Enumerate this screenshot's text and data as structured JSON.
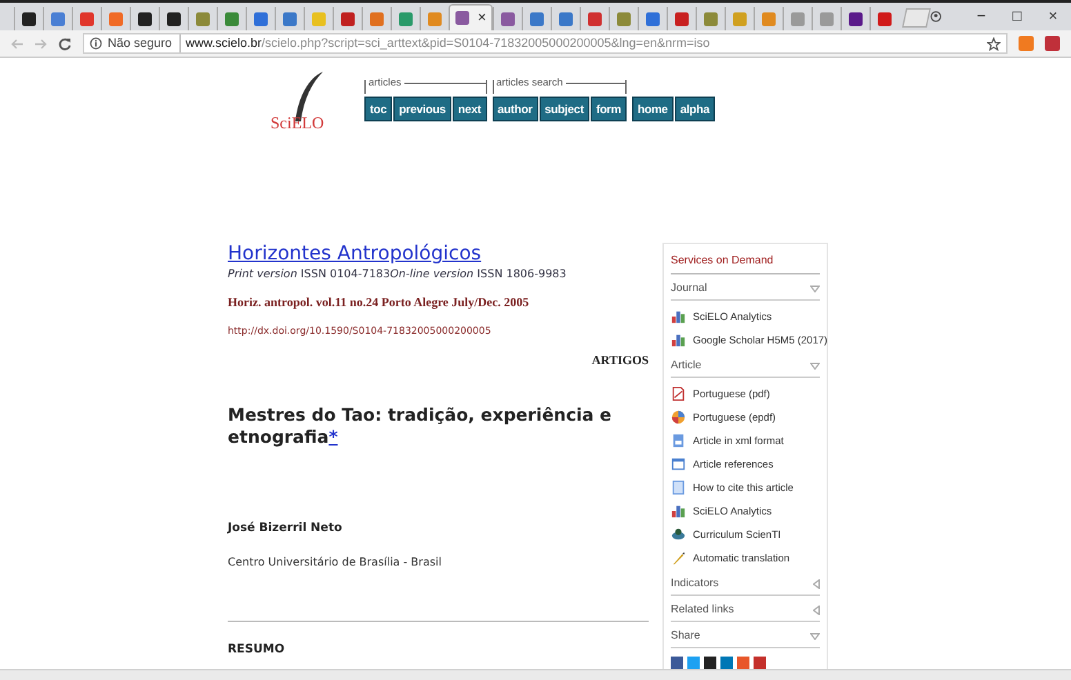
{
  "browser": {
    "tabs": [
      {
        "color": "#222222",
        "selected": false
      },
      {
        "color": "#4a7fd4",
        "selected": false
      },
      {
        "color": "#e0362c",
        "selected": false
      },
      {
        "color": "#f06a26",
        "selected": false
      },
      {
        "color": "#222222",
        "selected": false
      },
      {
        "color": "#222222",
        "selected": false
      },
      {
        "color": "#8c8a3a",
        "selected": false
      },
      {
        "color": "#3a8a3a",
        "selected": false
      },
      {
        "color": "#2f6fd8",
        "selected": false
      },
      {
        "color": "#3b78c8",
        "selected": false
      },
      {
        "color": "#e8c020",
        "selected": false
      },
      {
        "color": "#c02020",
        "selected": false
      },
      {
        "color": "#e07020",
        "selected": false
      },
      {
        "color": "#2a9a6a",
        "selected": false
      },
      {
        "color": "#e08a20",
        "selected": false
      },
      {
        "color": "#8a5aa0",
        "selected": true,
        "close": "×"
      },
      {
        "color": "#8a5aa0",
        "selected": false
      },
      {
        "color": "#3b78c8",
        "selected": false
      },
      {
        "color": "#3b78c8",
        "selected": false
      },
      {
        "color": "#d03030",
        "selected": false
      },
      {
        "color": "#8c8a3a",
        "selected": false
      },
      {
        "color": "#2f6fd8",
        "selected": false
      },
      {
        "color": "#c82020",
        "selected": false
      },
      {
        "color": "#8c8a3a",
        "selected": false
      },
      {
        "color": "#d0a020",
        "selected": false
      },
      {
        "color": "#e08a20",
        "selected": false
      },
      {
        "color": "#9a9a9a",
        "selected": false
      },
      {
        "color": "#9a9a9a",
        "selected": false
      },
      {
        "color": "#5a1a8a",
        "selected": false
      },
      {
        "color": "#d01a1a",
        "selected": false
      }
    ],
    "window_controls": [
      "−",
      "□",
      "×"
    ],
    "security": "Não seguro",
    "url_host": "www.scielo.br",
    "url_path": "/scielo.php?script=sci_arttext&pid=S0104-71832005000200005&lng=en&nrm=iso",
    "extensions": [
      {
        "color": "#f07a20"
      },
      {
        "color": "#c0303a"
      }
    ]
  },
  "page": {
    "logo": "SciELO",
    "nav_groups": [
      {
        "label": "articles",
        "buttons": [
          "toc",
          "previous",
          "next"
        ]
      },
      {
        "label": "articles search",
        "buttons": [
          "author",
          "subject",
          "form"
        ]
      },
      {
        "buttons": [
          "home",
          "alpha"
        ]
      }
    ],
    "journal_title": "Horizontes Antropológicos",
    "issn": [
      {
        "label": "Print version",
        "number": "ISSN 0104-7183"
      },
      {
        "label": "On-line version",
        "number": "ISSN 1806-9983"
      }
    ],
    "issue": "Horiz. antropol. vol.11 no.24 Porto Alegre July/Dec. 2005",
    "doi": "http://dx.doi.org/10.1590/S0104-71832005000200005",
    "section": "ARTIGOS",
    "article_title": "Mestres do Tao: tradição, experiência e etnografia",
    "footnote_mark": "*",
    "author": "José Bizerril Neto",
    "affiliation": "Centro Universitário de Brasília - Brasil",
    "abstract_heading": "RESUMO",
    "services": {
      "heading": "Services on Demand",
      "sections": [
        {
          "label": "Journal",
          "expanded": true,
          "items": [
            {
              "kind": "chart",
              "label": "SciELO Analytics"
            },
            {
              "kind": "chart",
              "label": "Google Scholar H5M5 (2017)"
            }
          ]
        },
        {
          "label": "Article",
          "expanded": true,
          "items": [
            {
              "kind": "pdf",
              "label": "Portuguese (pdf)"
            },
            {
              "kind": "epdf",
              "label": "Portuguese (epdf)"
            },
            {
              "kind": "xml",
              "label": "Article in xml format"
            },
            {
              "kind": "refs",
              "label": "Article references"
            },
            {
              "kind": "doc",
              "label": "How to cite this article"
            },
            {
              "kind": "chart",
              "label": "SciELO Analytics"
            },
            {
              "kind": "cv",
              "label": "Curriculum ScienTI"
            },
            {
              "kind": "translate",
              "label": "Automatic translation"
            }
          ]
        },
        {
          "label": "Indicators",
          "expanded": false
        },
        {
          "label": "Related links",
          "expanded": false
        },
        {
          "label": "Share",
          "expanded": true,
          "share": [
            {
              "color": "#3b5998"
            },
            {
              "color": "#1da1f2"
            },
            {
              "color": "#222222"
            },
            {
              "color": "#0077b5"
            },
            {
              "color": "#e8572a"
            },
            {
              "color": "#c4302b"
            }
          ]
        }
      ]
    }
  }
}
